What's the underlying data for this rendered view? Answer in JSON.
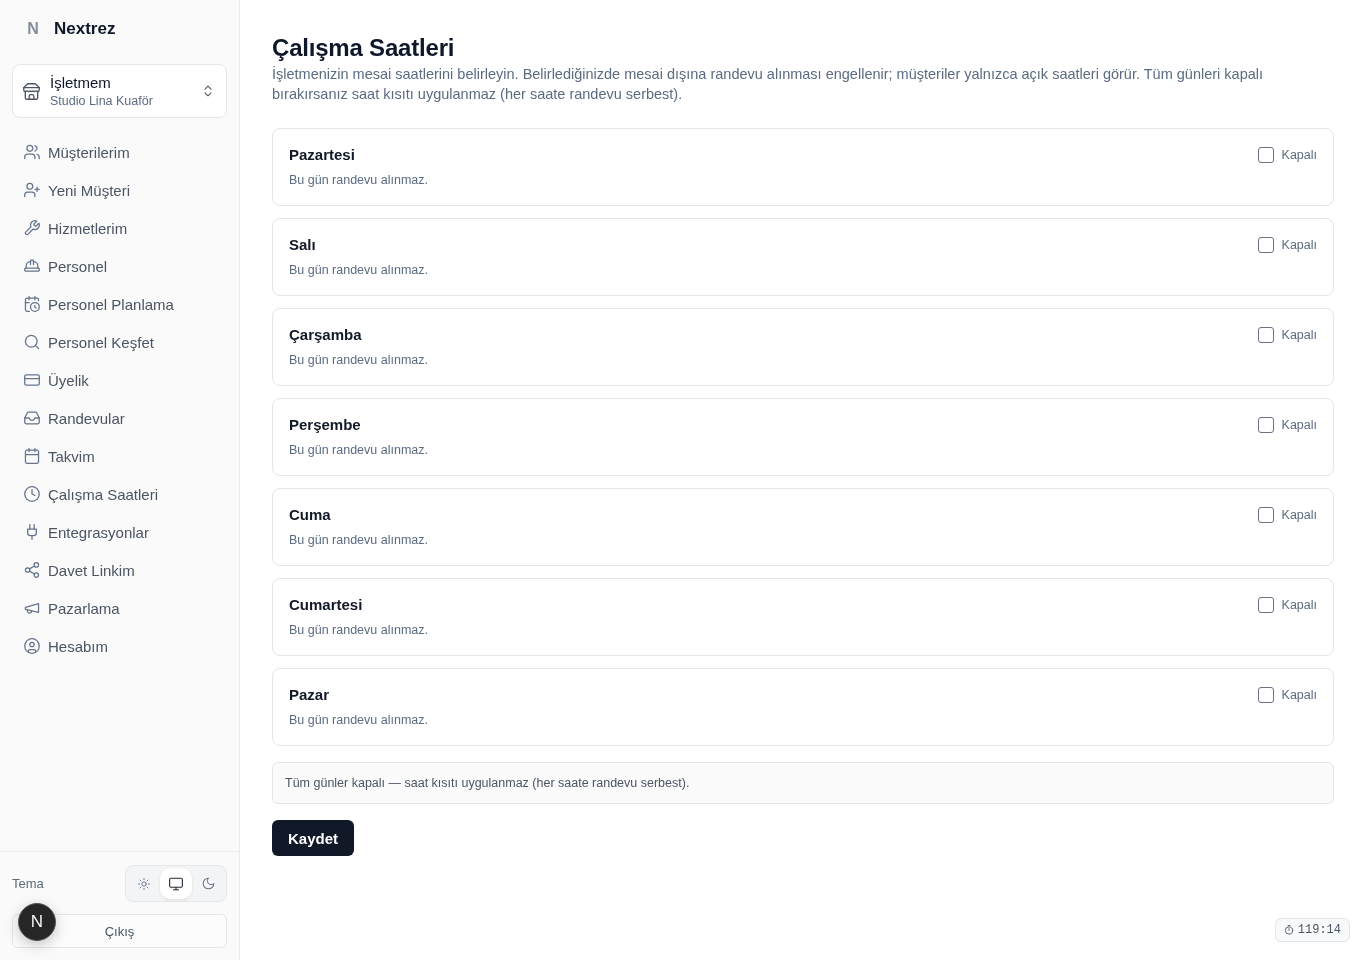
{
  "sidebar": {
    "logo": {
      "mark": "N",
      "name": "Nextrez"
    },
    "business": {
      "label": "İşletmem",
      "value": "Studio Lina Kuaför"
    },
    "items": [
      {
        "label": "Müşterilerim",
        "selected": false
      },
      {
        "label": "Yeni Müşteri",
        "selected": false
      },
      {
        "label": "Hizmetlerim",
        "selected": false
      },
      {
        "label": "Personel",
        "selected": false
      },
      {
        "label": "Personel Planlama",
        "selected": false
      },
      {
        "label": "Personel Keşfet",
        "selected": false
      },
      {
        "label": "Üyelik",
        "selected": false
      },
      {
        "label": "Randevular",
        "selected": false
      },
      {
        "label": "Takvim",
        "selected": false
      },
      {
        "label": "Çalışma Saatleri",
        "selected": false
      },
      {
        "label": "Entegrasyonlar",
        "selected": false
      },
      {
        "label": "Davet Linkim",
        "selected": false
      },
      {
        "label": "Pazarlama",
        "selected": false
      },
      {
        "label": "Hesabım",
        "selected": false
      }
    ],
    "theme": {
      "label": "Tema",
      "options": [
        {
          "kind": "light",
          "selected": false
        },
        {
          "kind": "system",
          "selected": true
        },
        {
          "kind": "dark",
          "selected": false
        }
      ]
    },
    "logout": "Çıkış"
  },
  "main": {
    "title": "Çalışma Saatleri",
    "description": "İşletmenizin mesai saatlerini belirleyin. Belirlediğinizde mesai dışına randevu alınması engellenir; müşteriler yalnızca açık saatleri görür. Tüm günleri kapalı bırakırsanız saat kısıtı uygulanmaz (her saate randevu serbest).",
    "days": [
      {
        "name": "Pazartesi",
        "note": "Bu gün randevu alınmaz.",
        "closed_label": "Kapalı",
        "checked": false
      },
      {
        "name": "Salı",
        "note": "Bu gün randevu alınmaz.",
        "closed_label": "Kapalı",
        "checked": false
      },
      {
        "name": "Çarşamba",
        "note": "Bu gün randevu alınmaz.",
        "closed_label": "Kapalı",
        "checked": false
      },
      {
        "name": "Perşembe",
        "note": "Bu gün randevu alınmaz.",
        "closed_label": "Kapalı",
        "checked": false
      },
      {
        "name": "Cuma",
        "note": "Bu gün randevu alınmaz.",
        "closed_label": "Kapalı",
        "checked": false
      },
      {
        "name": "Cumartesi",
        "note": "Bu gün randevu alınmaz.",
        "closed_label": "Kapalı",
        "checked": false
      },
      {
        "name": "Pazar",
        "note": "Bu gün randevu alınmaz.",
        "closed_label": "Kapalı",
        "checked": false
      }
    ],
    "info": "Tüm günler kapalı — saat kısıtı uygulanmaz (her saate randevu serbest).",
    "save": "Kaydet"
  },
  "dev_badge": {
    "label": "N"
  },
  "timer": {
    "label": "119:14"
  }
}
